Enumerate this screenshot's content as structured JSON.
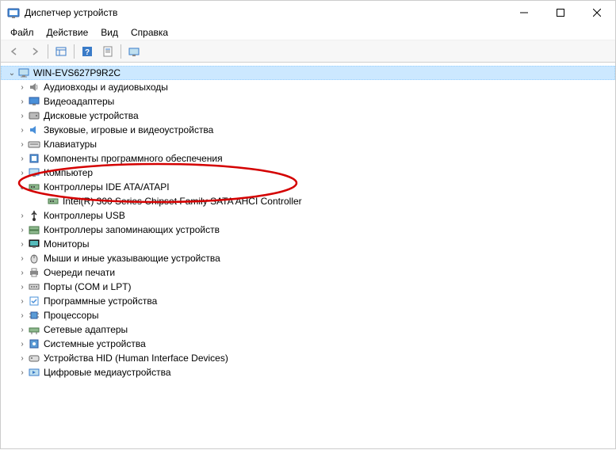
{
  "window": {
    "title": "Диспетчер устройств"
  },
  "menubar": {
    "file": "Файл",
    "action": "Действие",
    "view": "Вид",
    "help": "Справка"
  },
  "tree": {
    "root": "WIN-EVS627P9R2C",
    "nodes": [
      {
        "label": "Аудиовходы и аудиовыходы",
        "expanded": false,
        "icon": "audio"
      },
      {
        "label": "Видеоадаптеры",
        "expanded": false,
        "icon": "display"
      },
      {
        "label": "Дисковые устройства",
        "expanded": false,
        "icon": "disk"
      },
      {
        "label": "Звуковые, игровые и видеоустройства",
        "expanded": false,
        "icon": "sound"
      },
      {
        "label": "Клавиатуры",
        "expanded": false,
        "icon": "keyboard"
      },
      {
        "label": "Компоненты программного обеспечения",
        "expanded": false,
        "icon": "component"
      },
      {
        "label": "Компьютер",
        "expanded": false,
        "icon": "computer"
      },
      {
        "label": "Контроллеры IDE ATA/ATAPI",
        "expanded": true,
        "icon": "storage-ctrl",
        "children": [
          {
            "label": "Intel(R) 300 Series Chipset Family SATA AHCI Controller",
            "icon": "storage-ctrl"
          }
        ]
      },
      {
        "label": "Контроллеры USB",
        "expanded": false,
        "icon": "usb"
      },
      {
        "label": "Контроллеры запоминающих устройств",
        "expanded": false,
        "icon": "storage-ctrl2"
      },
      {
        "label": "Мониторы",
        "expanded": false,
        "icon": "monitor"
      },
      {
        "label": "Мыши и иные указывающие устройства",
        "expanded": false,
        "icon": "mouse"
      },
      {
        "label": "Очереди печати",
        "expanded": false,
        "icon": "printer"
      },
      {
        "label": "Порты (COM и LPT)",
        "expanded": false,
        "icon": "port"
      },
      {
        "label": "Программные устройства",
        "expanded": false,
        "icon": "software"
      },
      {
        "label": "Процессоры",
        "expanded": false,
        "icon": "cpu"
      },
      {
        "label": "Сетевые адаптеры",
        "expanded": false,
        "icon": "network"
      },
      {
        "label": "Системные устройства",
        "expanded": false,
        "icon": "system"
      },
      {
        "label": "Устройства HID (Human Interface Devices)",
        "expanded": false,
        "icon": "hid"
      },
      {
        "label": "Цифровые медиаустройства",
        "expanded": false,
        "icon": "media"
      }
    ]
  }
}
